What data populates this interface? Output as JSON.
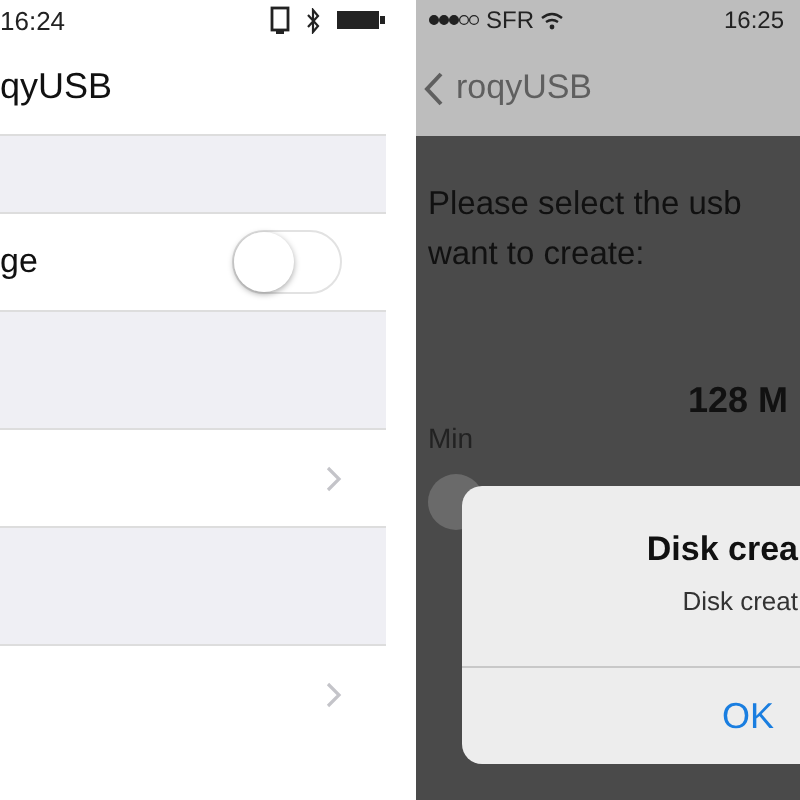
{
  "left_screen": {
    "status_bar": {
      "time": "16:24"
    },
    "nav_title": "qyUSB",
    "rows": [
      {
        "kind": "spacer"
      },
      {
        "kind": "switch",
        "label": "ge",
        "on": false
      },
      {
        "kind": "spacer"
      },
      {
        "kind": "link"
      },
      {
        "kind": "spacer"
      },
      {
        "kind": "link"
      }
    ]
  },
  "right_screen": {
    "status_bar": {
      "carrier": "SFR",
      "time": "16:25"
    },
    "nav": {
      "back_label": "roqyUSB"
    },
    "prompt_lines": [
      "Please select the usb",
      "want to create:"
    ],
    "size_value": "128 M",
    "slider": {
      "min_label": "Min",
      "level": 0
    },
    "alert": {
      "title": "Disk crea",
      "message": "Disk creat",
      "button": "OK"
    }
  }
}
